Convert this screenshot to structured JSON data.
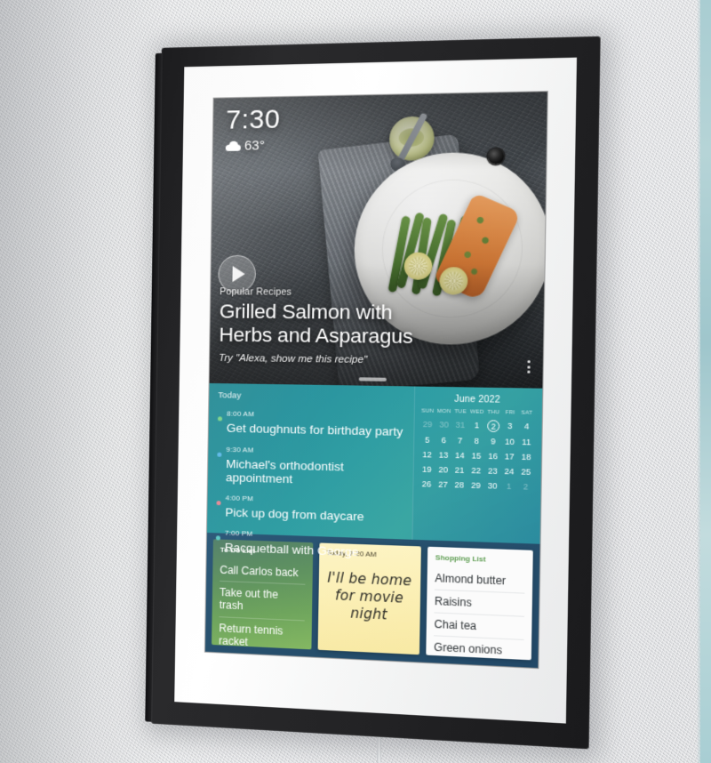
{
  "device": {
    "type": "smart-display-in-picture-frame",
    "frame_color": "#202022",
    "matte_color": "#fafafa"
  },
  "status": {
    "time": "7:30",
    "temperature": "63°",
    "weather_icon": "cloud-icon"
  },
  "hero": {
    "kicker": "Popular Recipes",
    "title": "Grilled Salmon with Herbs and Asparagus",
    "try_line": "Try \"Alexa, show me this recipe\"",
    "play_icon": "play-icon",
    "menu_icon": "kebab-menu-icon"
  },
  "agenda": {
    "label": "Today",
    "events": [
      {
        "time": "8:00 AM",
        "title": "Get doughnuts for birthday party",
        "color": "#7fd48a"
      },
      {
        "time": "9:30 AM",
        "title": "Michael's orthodontist appointment",
        "color": "#5fb9e8"
      },
      {
        "time": "4:00 PM",
        "title": "Pick up dog from daycare",
        "color": "#e88a96"
      },
      {
        "time": "7:00 PM",
        "title": "Racquetball with George",
        "color": "#5ec9c4"
      }
    ]
  },
  "calendar": {
    "title": "June 2022",
    "dow": [
      "SUN",
      "MON",
      "TUE",
      "WED",
      "THU",
      "FRI",
      "SAT"
    ],
    "today": 2,
    "days": [
      {
        "n": "29",
        "muted": true
      },
      {
        "n": "30",
        "muted": true
      },
      {
        "n": "31",
        "muted": true
      },
      {
        "n": "1"
      },
      {
        "n": "2",
        "today": true
      },
      {
        "n": "3"
      },
      {
        "n": "4"
      },
      {
        "n": "5"
      },
      {
        "n": "6"
      },
      {
        "n": "7"
      },
      {
        "n": "8"
      },
      {
        "n": "9"
      },
      {
        "n": "10"
      },
      {
        "n": "11"
      },
      {
        "n": "12"
      },
      {
        "n": "13"
      },
      {
        "n": "14"
      },
      {
        "n": "15"
      },
      {
        "n": "16"
      },
      {
        "n": "17"
      },
      {
        "n": "18"
      },
      {
        "n": "19"
      },
      {
        "n": "20"
      },
      {
        "n": "21"
      },
      {
        "n": "22"
      },
      {
        "n": "23"
      },
      {
        "n": "24"
      },
      {
        "n": "25"
      },
      {
        "n": "26"
      },
      {
        "n": "27"
      },
      {
        "n": "28"
      },
      {
        "n": "29"
      },
      {
        "n": "30"
      },
      {
        "n": "1",
        "muted": true
      },
      {
        "n": "2",
        "muted": true
      }
    ]
  },
  "todo": {
    "label": "To-Do List",
    "items": [
      "Call Carlos back",
      "Take out the trash",
      "Return tennis racket"
    ]
  },
  "note": {
    "date": "Today, 7:20 AM",
    "body": "I'll be home for movie night"
  },
  "shopping": {
    "label": "Shopping List",
    "items": [
      "Almond butter",
      "Raisins",
      "Chai tea",
      "Green onions"
    ]
  },
  "colors": {
    "teal_band": "#2f9fa6",
    "navy_row": "#27506d",
    "todo_green": "#6fa55d",
    "note_yellow": "#fbefb4",
    "shopping_label": "#5e9d52"
  }
}
